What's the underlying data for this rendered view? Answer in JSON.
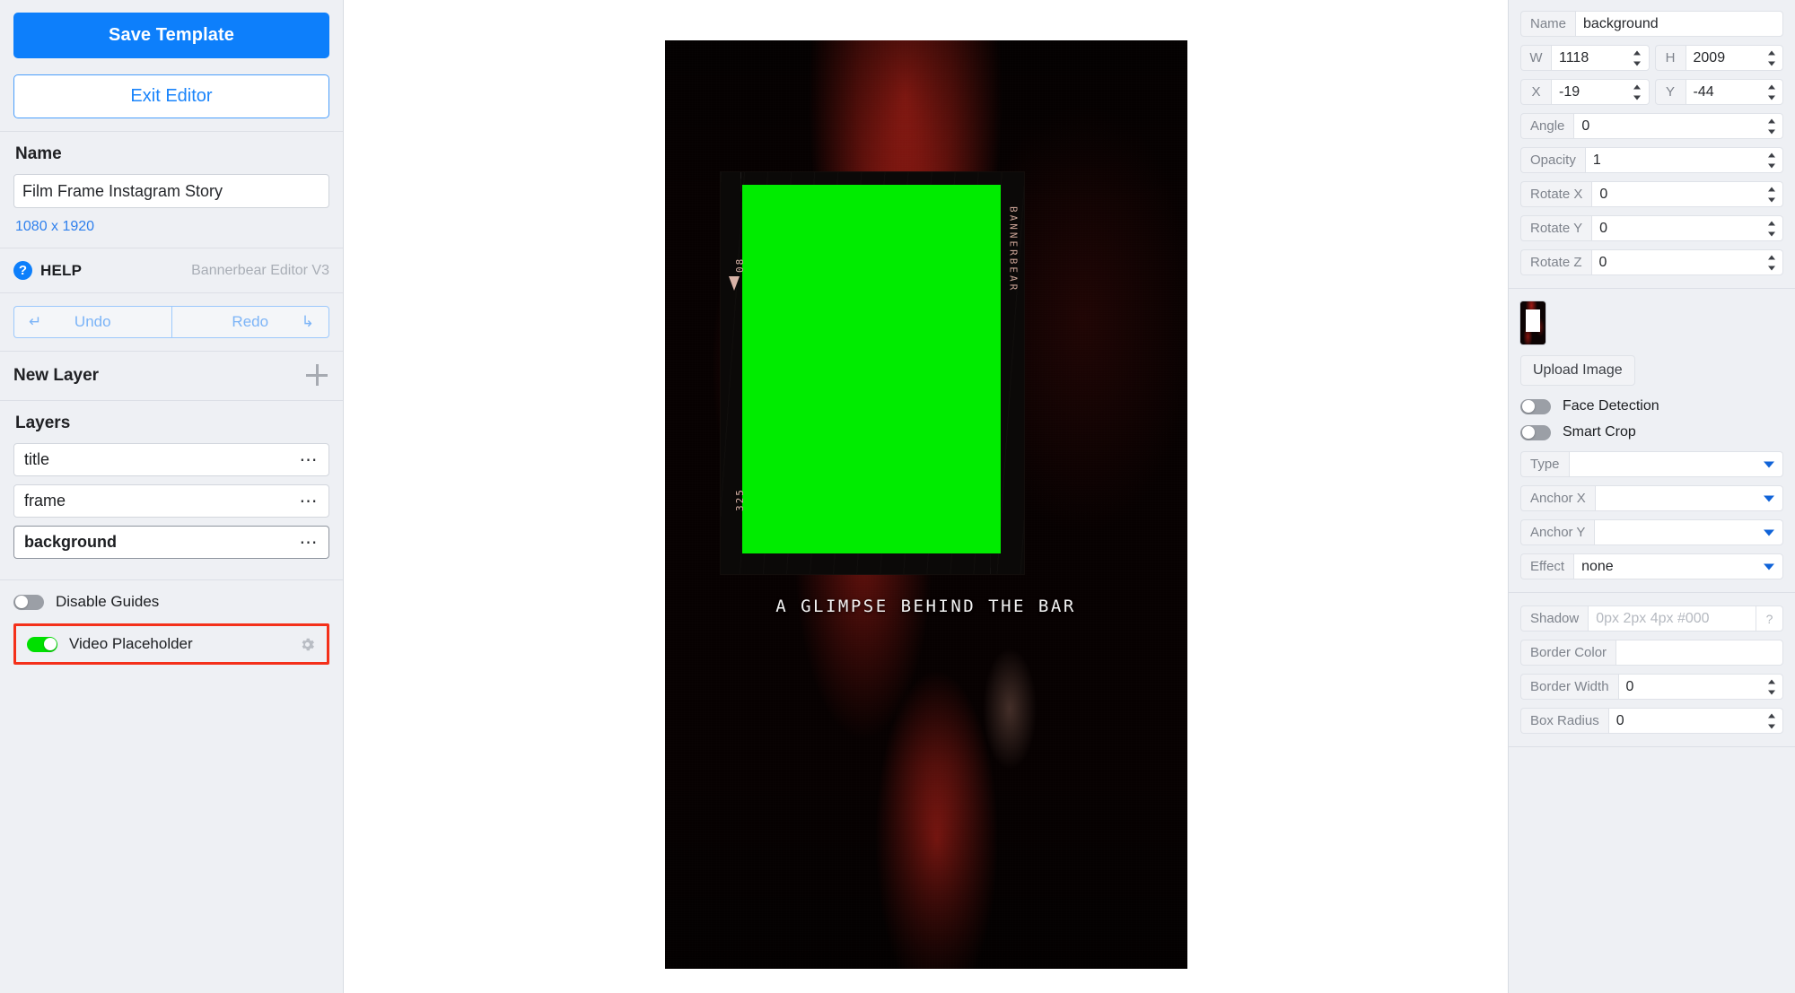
{
  "sidebar": {
    "save_label": "Save Template",
    "exit_label": "Exit Editor",
    "name_heading": "Name",
    "name_value": "Film Frame Instagram Story",
    "dimensions_link": "1080 x 1920",
    "help_label": "HELP",
    "editor_version": "Bannerbear Editor V3",
    "undo_label": "Undo",
    "redo_label": "Redo",
    "undo_icon": "undo-arrow-icon",
    "redo_icon": "redo-arrow-icon",
    "new_layer_label": "New Layer",
    "add_layer_icon": "plus-icon",
    "layers_heading": "Layers",
    "layers": [
      {
        "name": "title",
        "selected": false,
        "menu_icon": "ellipsis-icon"
      },
      {
        "name": "frame",
        "selected": false,
        "menu_icon": "ellipsis-icon"
      },
      {
        "name": "background",
        "selected": true,
        "menu_icon": "ellipsis-icon"
      }
    ],
    "disable_guides_label": "Disable Guides",
    "disable_guides_on": false,
    "video_placeholder_label": "Video Placeholder",
    "video_placeholder_on": true,
    "video_placeholder_settings_icon": "gear-icon",
    "highlight_color": "#f4301a"
  },
  "canvas": {
    "caption_text": "A GLIMPSE BEHIND THE BAR",
    "frame_number_top": "08",
    "frame_number_bottom": "325",
    "frame_brand": "BANNERBEAR",
    "placeholder_color": "#00ec00"
  },
  "properties": {
    "name_label": "Name",
    "name_value": "background",
    "w_label": "W",
    "w_value": "1118",
    "h_label": "H",
    "h_value": "2009",
    "x_label": "X",
    "x_value": "-19",
    "y_label": "Y",
    "y_value": "-44",
    "angle_label": "Angle",
    "angle_value": "0",
    "opacity_label": "Opacity",
    "opacity_value": "1",
    "rotate_x_label": "Rotate X",
    "rotate_x_value": "0",
    "rotate_y_label": "Rotate Y",
    "rotate_y_value": "0",
    "rotate_z_label": "Rotate Z",
    "rotate_z_value": "0",
    "upload_label": "Upload Image",
    "face_detection_label": "Face Detection",
    "face_detection_on": false,
    "smart_crop_label": "Smart Crop",
    "smart_crop_on": false,
    "type_label": "Type",
    "type_value": "",
    "anchor_x_label": "Anchor X",
    "anchor_x_value": "",
    "anchor_y_label": "Anchor Y",
    "anchor_y_value": "",
    "effect_label": "Effect",
    "effect_value": "none",
    "shadow_label": "Shadow",
    "shadow_placeholder": "0px 2px 4px #000",
    "shadow_help_icon": "question-circle-icon",
    "border_color_label": "Border Color",
    "border_color_value": "",
    "border_width_label": "Border Width",
    "border_width_value": "0",
    "box_radius_label": "Box Radius",
    "box_radius_value": "0"
  }
}
